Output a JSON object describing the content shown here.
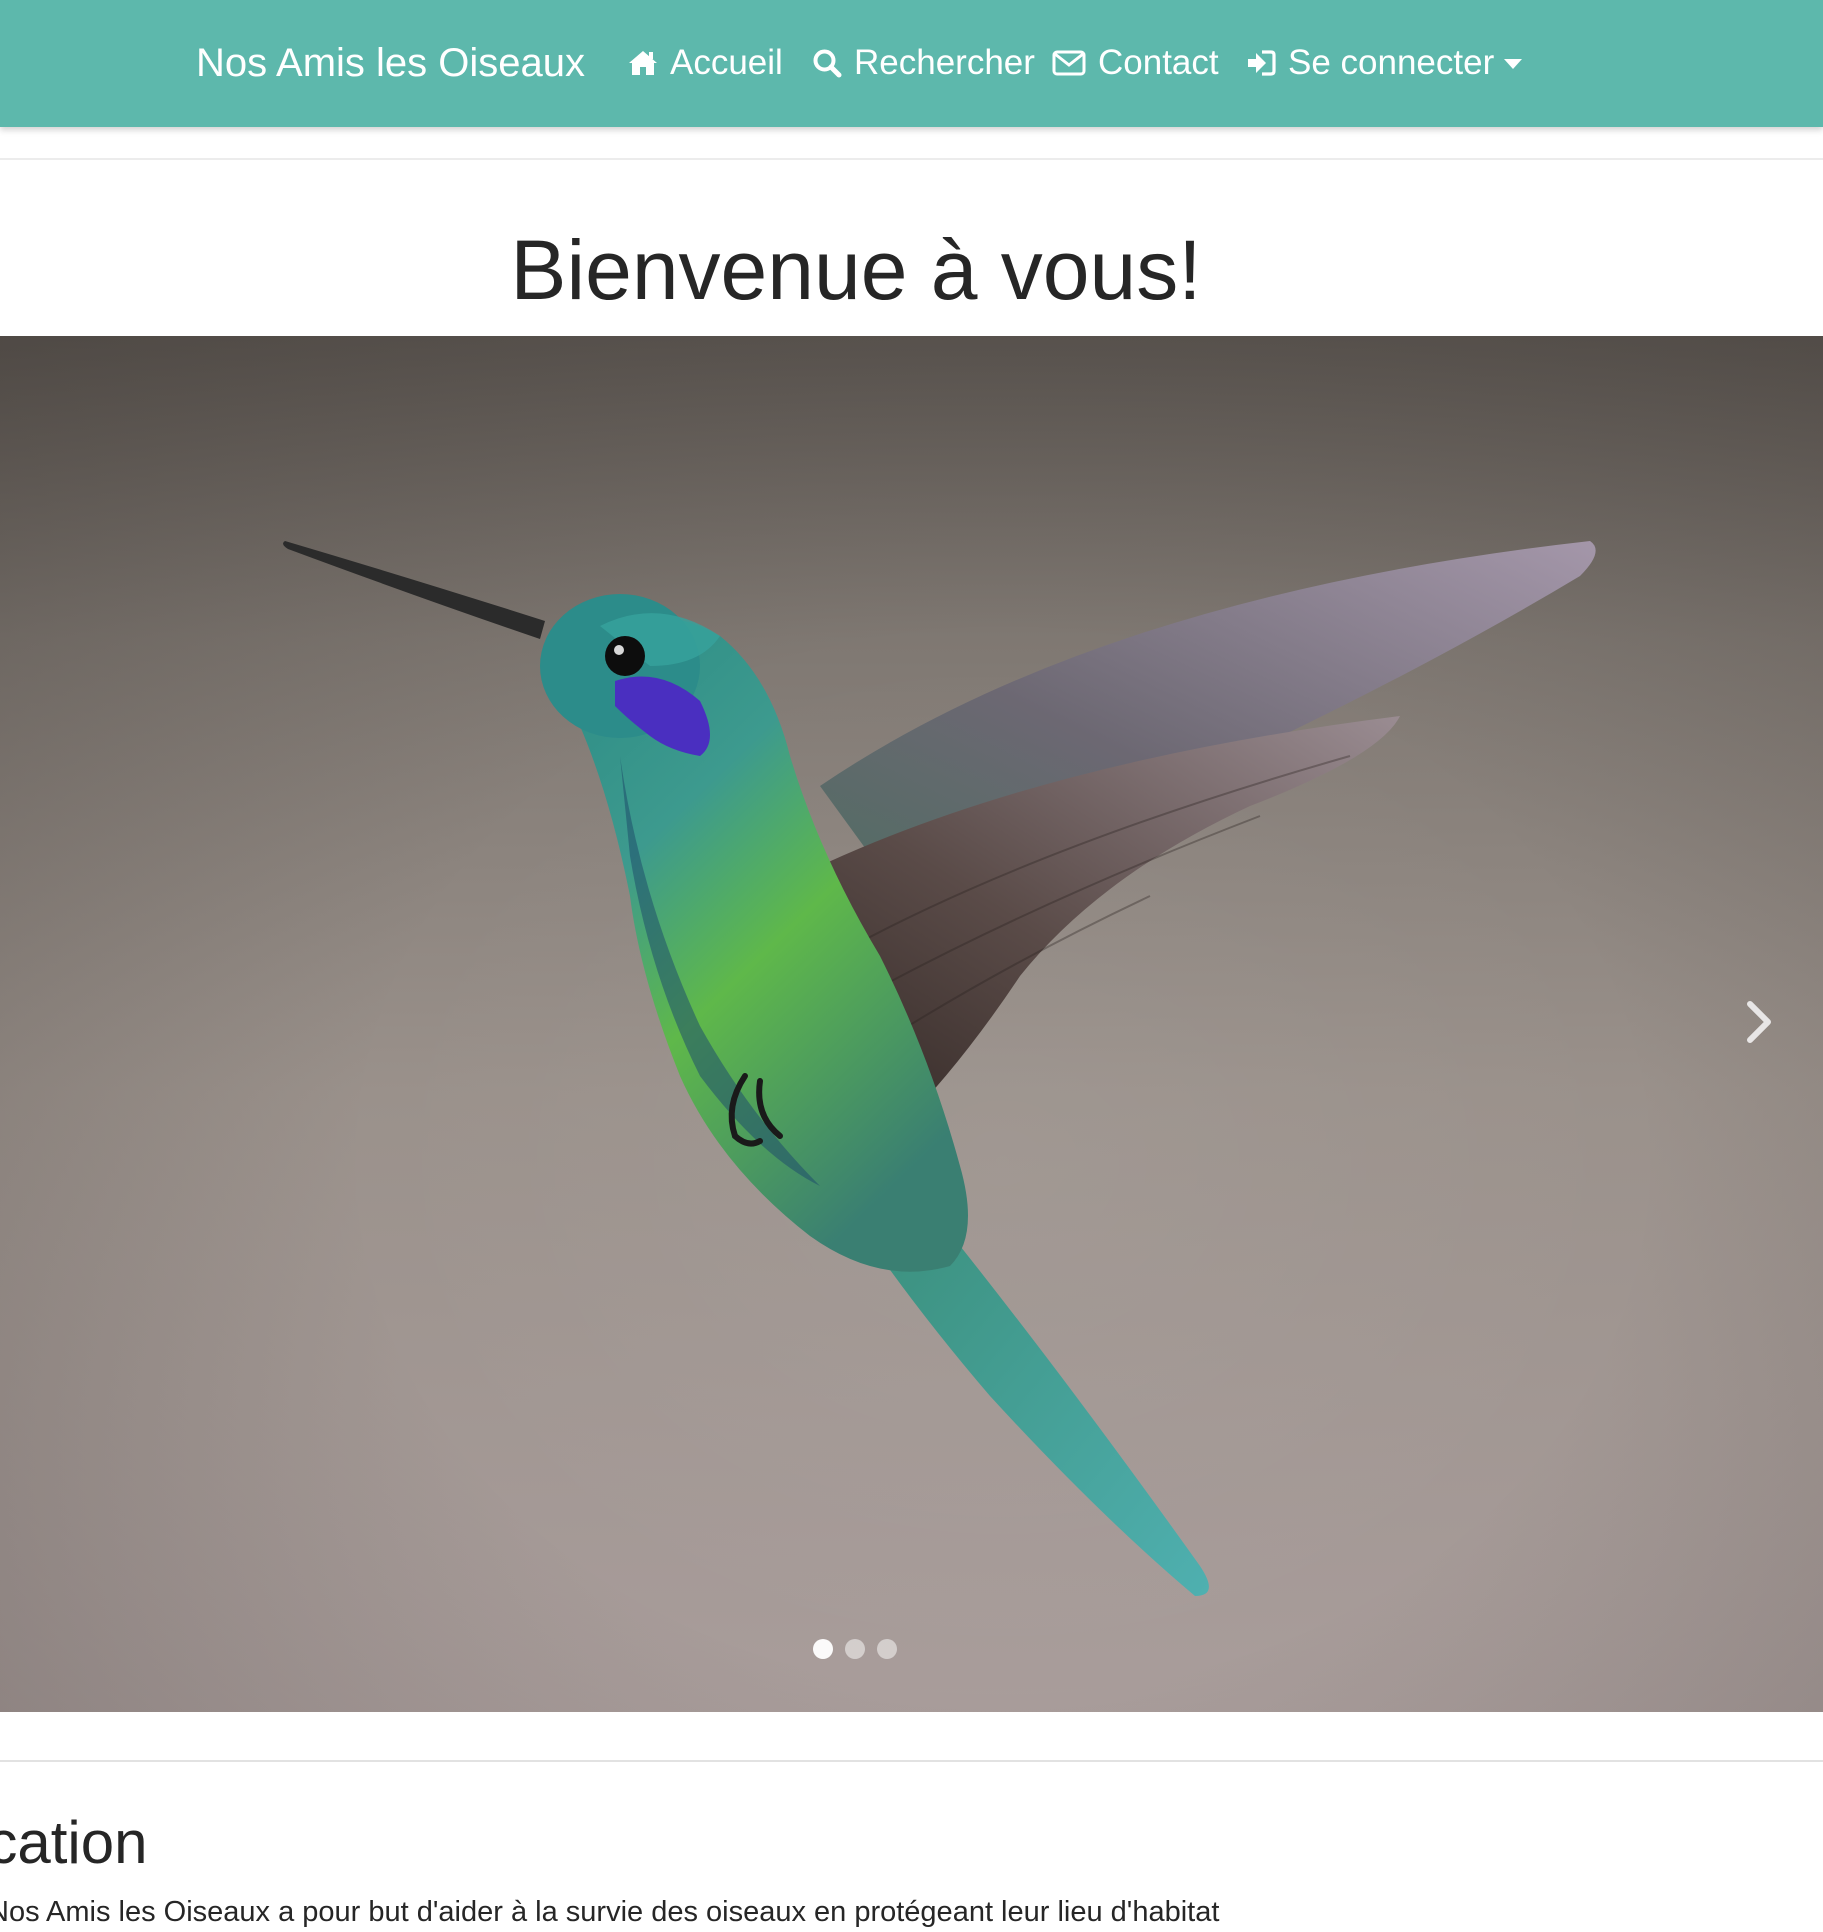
{
  "navbar": {
    "brand": "Nos Amis les Oiseaux",
    "background_color": "#5db8ac",
    "items": [
      {
        "label": "Accueil",
        "icon": "home-icon"
      },
      {
        "label": "Rechercher",
        "icon": "search-icon"
      },
      {
        "label": "Contact",
        "icon": "envelope-icon"
      },
      {
        "label": "Se connecter",
        "icon": "sign-in-icon",
        "dropdown": true
      }
    ]
  },
  "main": {
    "title": "Bienvenue à vous!"
  },
  "carousel": {
    "slide_image": "hummingbird-photo",
    "indicators": [
      {
        "active": true
      },
      {
        "active": false
      },
      {
        "active": false
      }
    ],
    "next_icon": "chevron-right-icon"
  },
  "section": {
    "heading": "ocation",
    "text": "Nos Amis les Oiseaux a pour but d'aider à la survie des oiseaux en protégeant leur lieu d'habitat"
  }
}
